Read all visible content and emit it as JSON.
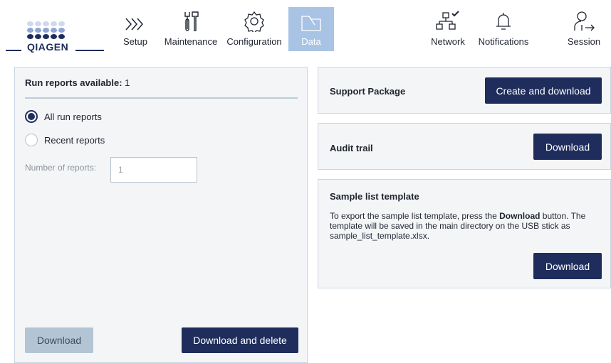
{
  "brand": {
    "logo_text": "QIAGEN"
  },
  "nav": {
    "items": [
      {
        "label": "Setup",
        "icon": "chevrons-right-icon"
      },
      {
        "label": "Maintenance",
        "icon": "tools-icon"
      },
      {
        "label": "Configuration",
        "icon": "gear-icon"
      },
      {
        "label": "Data",
        "icon": "folder-icon",
        "active": true
      },
      {
        "label": "Network",
        "icon": "network-icon"
      },
      {
        "label": "Notifications",
        "icon": "bell-icon"
      },
      {
        "label": "Session",
        "icon": "user-logout-icon"
      }
    ]
  },
  "run_reports": {
    "title_bold": "Run reports available:",
    "count": "1",
    "option_all": "All run reports",
    "option_recent": "Recent reports",
    "selected": "All run reports",
    "number_label": "Number of reports:",
    "number_value": "1",
    "download_label": "Download",
    "download_delete_label": "Download and delete"
  },
  "support_package": {
    "title": "Support Package",
    "button_label": "Create and download"
  },
  "audit_trail": {
    "title": "Audit trail",
    "button_label": "Download"
  },
  "sample_list": {
    "title": "Sample list template",
    "text_before": "To export the sample list template, press the ",
    "text_bold": "Download",
    "text_after": " button. The template will be saved in the main directory on the USB stick as sample_list_template.xlsx.",
    "button_label": "Download"
  },
  "colors": {
    "primary": "#1f2d5c",
    "active_tab": "#a9c3e4",
    "panel_bg": "#f4f5f7",
    "disabled_button": "#b3c5d4"
  }
}
